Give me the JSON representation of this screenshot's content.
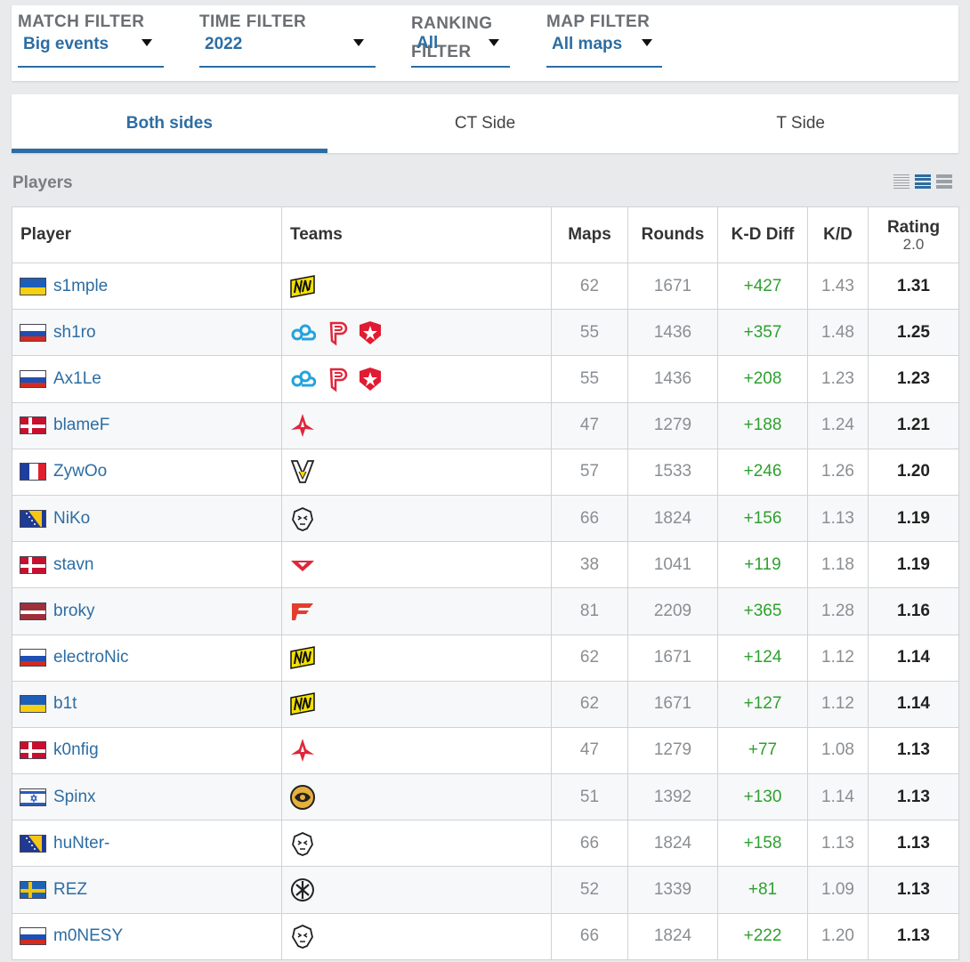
{
  "filters": {
    "match": {
      "title": "MATCH FILTER",
      "value": "Big events"
    },
    "time": {
      "title": "TIME FILTER",
      "value": "2022"
    },
    "ranking": {
      "title": "RANKING FILTER",
      "value": "All"
    },
    "map": {
      "title": "MAP FILTER",
      "value": "All maps"
    }
  },
  "tabs": [
    "Both sides",
    "CT Side",
    "T Side"
  ],
  "active_tab": "Both sides",
  "section_title": "Players",
  "accent_color": "#2d6da3",
  "positive_color": "#2ea02e",
  "table": {
    "headers": {
      "player": "Player",
      "teams": "Teams",
      "maps": "Maps",
      "rounds": "Rounds",
      "kd_diff": "K-D Diff",
      "kd": "K/D",
      "rating": "Rating",
      "rating_sub": "2.0"
    },
    "rows": [
      {
        "player": "s1mple",
        "flag": "ukraine",
        "teams": [
          "navi"
        ],
        "maps": "62",
        "rounds": "1671",
        "kd_diff": "+427",
        "kd": "1.43",
        "rating": "1.31"
      },
      {
        "player": "sh1ro",
        "flag": "russia",
        "teams": [
          "cloud9",
          "outsiders",
          "gambit"
        ],
        "maps": "55",
        "rounds": "1436",
        "kd_diff": "+357",
        "kd": "1.48",
        "rating": "1.25"
      },
      {
        "player": "Ax1Le",
        "flag": "russia",
        "teams": [
          "cloud9",
          "outsiders",
          "gambit"
        ],
        "maps": "55",
        "rounds": "1436",
        "kd_diff": "+208",
        "kd": "1.23",
        "rating": "1.23"
      },
      {
        "player": "blameF",
        "flag": "denmark",
        "teams": [
          "astralis"
        ],
        "maps": "47",
        "rounds": "1279",
        "kd_diff": "+188",
        "kd": "1.24",
        "rating": "1.21"
      },
      {
        "player": "ZywOo",
        "flag": "france",
        "teams": [
          "vitality"
        ],
        "maps": "57",
        "rounds": "1533",
        "kd_diff": "+246",
        "kd": "1.26",
        "rating": "1.20"
      },
      {
        "player": "NiKo",
        "flag": "bosnia",
        "teams": [
          "g2"
        ],
        "maps": "66",
        "rounds": "1824",
        "kd_diff": "+156",
        "kd": "1.13",
        "rating": "1.19"
      },
      {
        "player": "stavn",
        "flag": "denmark",
        "teams": [
          "heroic"
        ],
        "maps": "38",
        "rounds": "1041",
        "kd_diff": "+119",
        "kd": "1.18",
        "rating": "1.19"
      },
      {
        "player": "broky",
        "flag": "latvia",
        "teams": [
          "faze"
        ],
        "maps": "81",
        "rounds": "2209",
        "kd_diff": "+365",
        "kd": "1.28",
        "rating": "1.16"
      },
      {
        "player": "electroNic",
        "flag": "russia",
        "teams": [
          "navi"
        ],
        "maps": "62",
        "rounds": "1671",
        "kd_diff": "+124",
        "kd": "1.12",
        "rating": "1.14"
      },
      {
        "player": "b1t",
        "flag": "ukraine",
        "teams": [
          "navi"
        ],
        "maps": "62",
        "rounds": "1671",
        "kd_diff": "+127",
        "kd": "1.12",
        "rating": "1.14"
      },
      {
        "player": "k0nfig",
        "flag": "denmark",
        "teams": [
          "astralis"
        ],
        "maps": "47",
        "rounds": "1279",
        "kd_diff": "+77",
        "kd": "1.08",
        "rating": "1.13"
      },
      {
        "player": "Spinx",
        "flag": "israel",
        "teams": [
          "ence"
        ],
        "maps": "51",
        "rounds": "1392",
        "kd_diff": "+130",
        "kd": "1.14",
        "rating": "1.13"
      },
      {
        "player": "huNter-",
        "flag": "bosnia",
        "teams": [
          "g2"
        ],
        "maps": "66",
        "rounds": "1824",
        "kd_diff": "+158",
        "kd": "1.13",
        "rating": "1.13"
      },
      {
        "player": "REZ",
        "flag": "sweden",
        "teams": [
          "nip"
        ],
        "maps": "52",
        "rounds": "1339",
        "kd_diff": "+81",
        "kd": "1.09",
        "rating": "1.13"
      },
      {
        "player": "m0NESY",
        "flag": "russia",
        "teams": [
          "g2"
        ],
        "maps": "66",
        "rounds": "1824",
        "kd_diff": "+222",
        "kd": "1.20",
        "rating": "1.13"
      }
    ]
  }
}
